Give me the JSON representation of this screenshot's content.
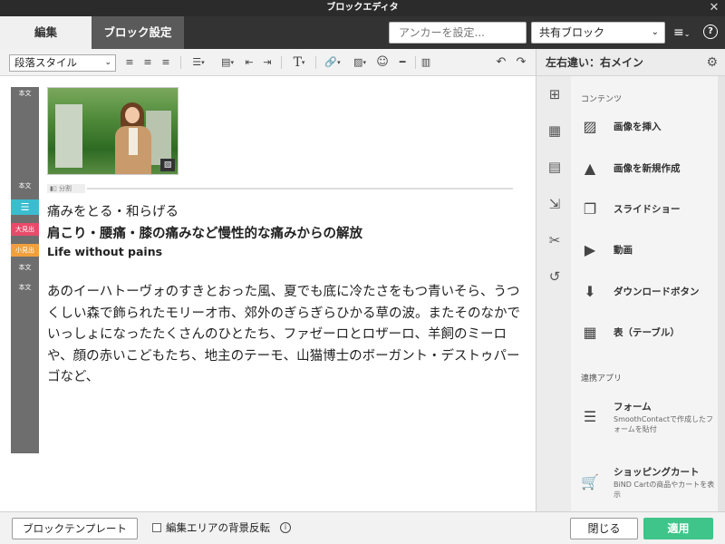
{
  "window": {
    "title": "ブロックエディタ",
    "close_glyph": "✕"
  },
  "tabs": [
    {
      "label": "編集"
    },
    {
      "label": "ブロック設定"
    }
  ],
  "header": {
    "anchor_placeholder": "アンカーを設定...",
    "shared_block_value": "共有ブロック",
    "menu_glyph": "≡",
    "help_glyph": "?"
  },
  "toolbar": {
    "paragraph_style": "段落スタイル"
  },
  "gutter": {
    "labels": [
      "本文",
      "本文",
      "大見出",
      "小見出",
      "本文",
      "本文"
    ],
    "para_icon": "☰"
  },
  "editor": {
    "split_tag": "分割",
    "paragraph": "痛みをとる・和らげる",
    "heading_large": "肩こり・腰痛・膝の痛みなど慢性的な痛みからの解放",
    "heading_small": "Life without pains",
    "body": "あのイーハトーヴォのすきとおった風、夏でも底に冷たさをもつ青いそら、うつくしい森で飾られたモリーオ市、郊外のぎらぎらひかる草の波。またそのなかでいっしょになったたくさんのひとたち、ファゼーロとロザーロ、羊飼のミーロや、顔の赤いこどもたち、地主のテーモ、山猫博士のボーガント・デストゥパーゴなど、"
  },
  "right_panel": {
    "title": "左右違い：右メイン",
    "sections": {
      "contents": "コンテンツ",
      "apps": "連携アプリ"
    },
    "items": [
      {
        "label": "画像を挿入",
        "icon": "image-icon"
      },
      {
        "label": "画像を新規作成",
        "icon": "shapes-icon"
      },
      {
        "label": "スライドショー",
        "icon": "slideshow-icon"
      },
      {
        "label": "動画",
        "icon": "video-icon"
      },
      {
        "label": "ダウンロードボタン",
        "icon": "download-icon"
      },
      {
        "label": "表（テーブル）",
        "icon": "table-icon"
      }
    ],
    "apps": [
      {
        "label": "フォーム",
        "desc": "SmoothContactで作成したフォームを貼付",
        "icon": "form-icon"
      },
      {
        "label": "ショッピングカート",
        "desc": "BiND Cartの商品やカートを表示",
        "icon": "cart-icon"
      }
    ]
  },
  "bottom": {
    "template_button": "ブロックテンプレート",
    "checkbox_label": "編集エリアの背景反転",
    "close_button": "閉じる",
    "apply_button": "適用"
  }
}
